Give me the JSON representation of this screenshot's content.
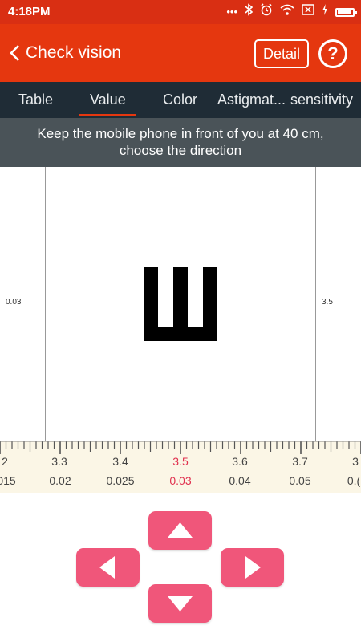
{
  "status_bar": {
    "time": "4:18PM",
    "icons": [
      "dots-icon",
      "bluetooth-icon",
      "alarm-icon",
      "wifi-icon",
      "no-sim-icon",
      "charging-icon",
      "battery-icon"
    ],
    "battery_level": 0.8
  },
  "toolbar": {
    "back_label": "Check vision",
    "detail_label": "Detail",
    "help_label": "?"
  },
  "tabs": [
    {
      "label": "Table",
      "active": false
    },
    {
      "label": "Value",
      "active": true
    },
    {
      "label": "Color",
      "active": false
    },
    {
      "label": "Astigmat...",
      "active": false
    },
    {
      "label": "sensitivity",
      "active": false
    }
  ],
  "instruction": {
    "line1": "Keep the mobile phone in front of you at 40 cm,",
    "line2": "choose the direction"
  },
  "test": {
    "left_label": "0.03",
    "right_label": "3.5",
    "optotype": "E",
    "optotype_direction": "up",
    "optotype_icon": "tumbling-e-icon"
  },
  "ruler": {
    "top_values": [
      "2",
      "3.3",
      "3.4",
      "3.5",
      "3.6",
      "3.7",
      "3"
    ],
    "bottom_values": [
      "015",
      "0.02",
      "0.025",
      "0.03",
      "0.04",
      "0.05",
      "0.("
    ],
    "selected_index": 3,
    "selected_color": "#e0304e"
  },
  "colors": {
    "header": "#e5370f",
    "tabs_bg": "#1f2c36",
    "instruction_bg": "#4a5358",
    "pad": "#f0567a",
    "ruler_bg": "#fbf6e6"
  },
  "pad": {
    "up_icon": "arrow-up-icon",
    "down_icon": "arrow-down-icon",
    "left_icon": "arrow-left-icon",
    "right_icon": "arrow-right-icon"
  }
}
